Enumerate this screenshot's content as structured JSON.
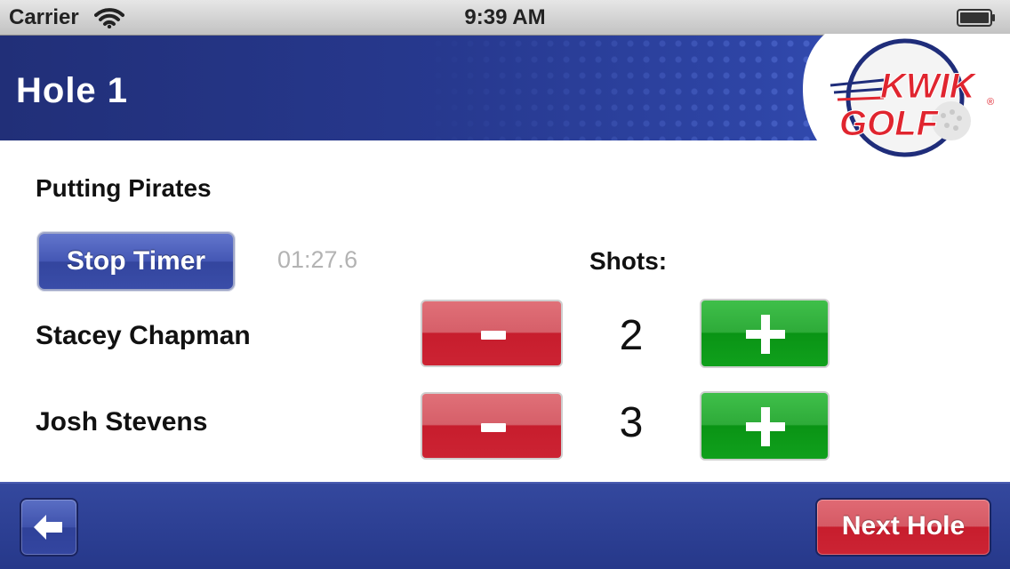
{
  "status_bar": {
    "carrier": "Carrier",
    "time": "9:39 AM",
    "wifi_icon": "wifi-icon",
    "battery_icon": "battery-icon"
  },
  "header": {
    "title": "Hole 1",
    "logo": {
      "line1": "KWIK",
      "line2": "GOLF",
      "registered_mark": "®"
    }
  },
  "main": {
    "team_name": "Putting Pirates",
    "stop_timer_label": "Stop Timer",
    "timer_value": "01:27.6",
    "shots_label": "Shots:",
    "players": [
      {
        "name": "Stacey Chapman",
        "shots": "2",
        "minus_label": "-",
        "plus_label": "+"
      },
      {
        "name": "Josh Stevens",
        "shots": "3",
        "minus_label": "-",
        "plus_label": "+"
      }
    ]
  },
  "footer": {
    "back_icon": "back-arrow-icon",
    "next_label": "Next Hole"
  },
  "colors": {
    "header_blue": "#27398f",
    "minus_red": "#c71d2d",
    "plus_green": "#0a9415",
    "logo_red": "#e0252f",
    "logo_navy": "#1f2d7a"
  }
}
